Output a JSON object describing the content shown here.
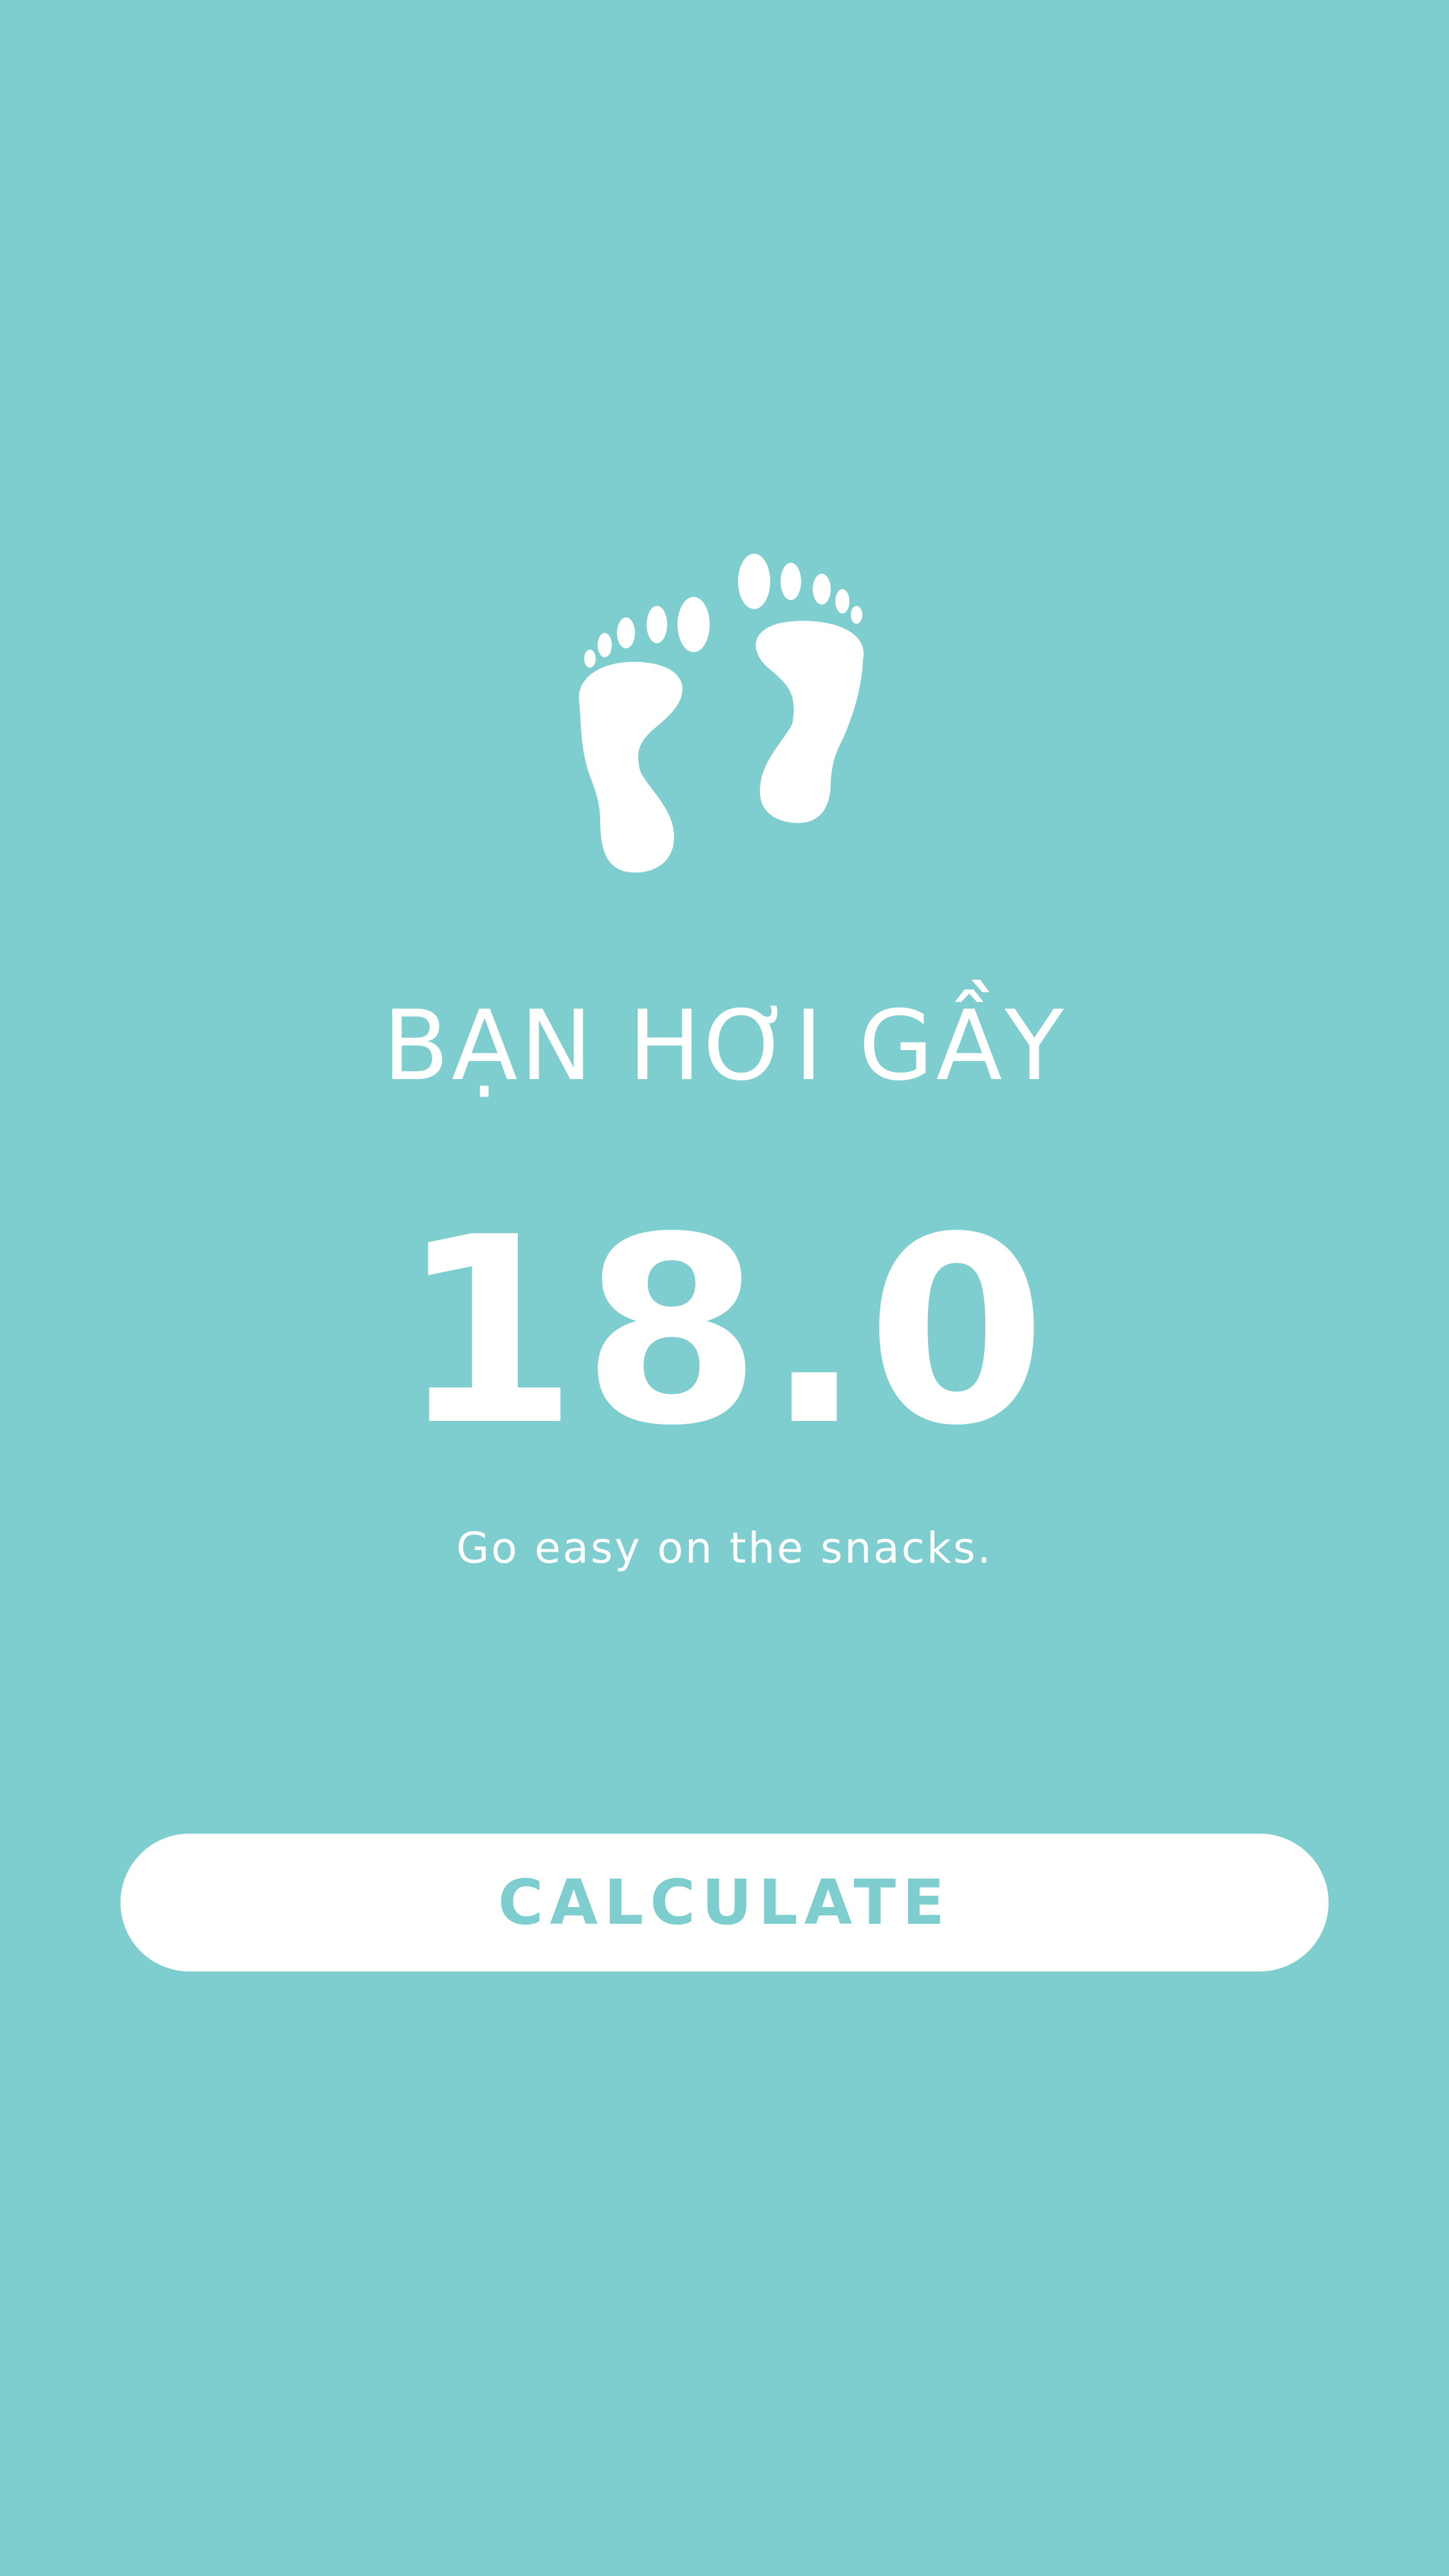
{
  "colors": {
    "background": "#7ecdcf",
    "foreground": "#ffffff",
    "button_background": "#ffffff",
    "button_text": "#7ecdcf"
  },
  "icon": "feet-icon",
  "result": {
    "title": "BẠN HƠI GẦY",
    "score": "18.0",
    "message": "Go easy on the snacks."
  },
  "actions": {
    "calculate_label": "CALCULATE"
  }
}
